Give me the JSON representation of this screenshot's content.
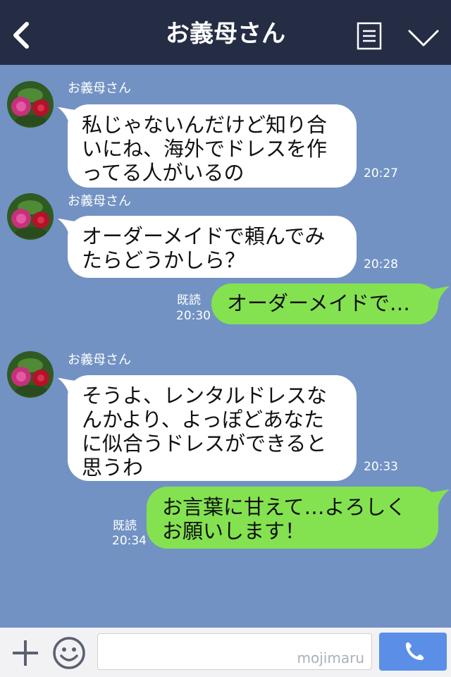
{
  "header": {
    "title": "お義母さん"
  },
  "messages": [
    {
      "sender": "お義母さん",
      "text": "私じゃないんだけど知り合\nいにね、海外でドレスを作\nってる人がいるの",
      "time": "20:27"
    },
    {
      "sender": "お義母さん",
      "text": "オーダーメイドで頼んでみ\nたらどうかしら？",
      "time": "20:28"
    },
    {
      "text": "オーダーメイドで…",
      "read": "既読",
      "time": "20:30"
    },
    {
      "sender": "お義母さん",
      "text": "そうよ、レンタルドレスな\nんかより、よっぽどあなた\nに似合うドレスができると\n思うわ",
      "time": "20:33"
    },
    {
      "text": "お言葉に甘えて…よろしく\nお願いします！",
      "read": "既読",
      "time": "20:34"
    }
  ],
  "footer": {
    "input_value": "",
    "watermark": "mojimaru"
  },
  "colors": {
    "header_bg": "#252d45",
    "chat_bg": "#7292c3",
    "outgoing_bubble": "#84e250",
    "incoming_bubble": "#ffffff",
    "call_button": "#5b8ee6"
  },
  "icons": {
    "back": "chevron-left-icon",
    "menu": "list-icon",
    "dropdown": "chevron-down-icon",
    "add": "plus-icon",
    "sticker": "smile-icon",
    "call": "phone-icon"
  }
}
